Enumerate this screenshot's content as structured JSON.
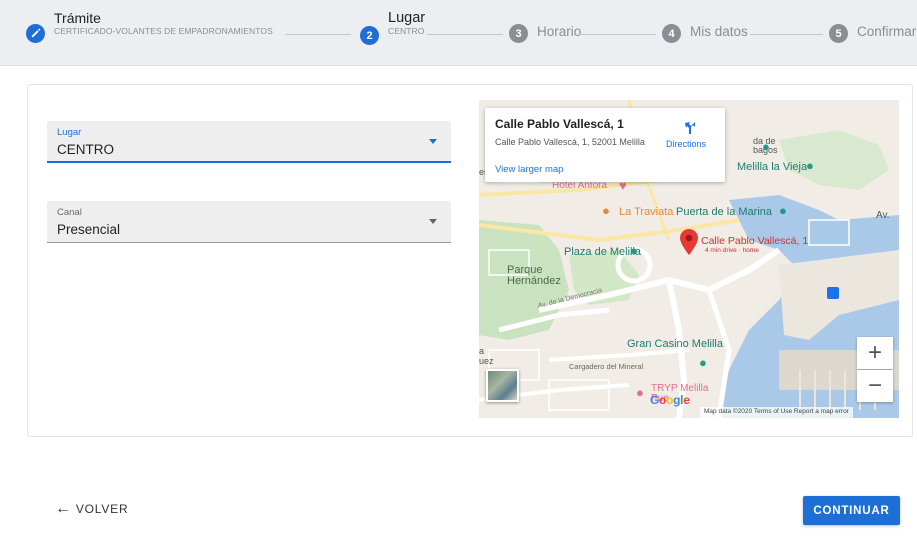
{
  "stepper": {
    "steps": [
      {
        "number": "",
        "title": "Trámite",
        "subtitle": "CERTIFICADO-VOLANTES DE EMPADRONAMIENTOS",
        "state": "done"
      },
      {
        "number": "2",
        "title": "Lugar",
        "subtitle": "CENTRO",
        "state": "active"
      },
      {
        "number": "3",
        "title": "Horario",
        "subtitle": "",
        "state": "todo"
      },
      {
        "number": "4",
        "title": "Mis datos",
        "subtitle": "",
        "state": "todo"
      },
      {
        "number": "5",
        "title": "Confirmar",
        "subtitle": "",
        "state": "todo"
      }
    ]
  },
  "form": {
    "lugar": {
      "label": "Lugar",
      "value": "CENTRO"
    },
    "canal": {
      "label": "Canal",
      "value": "Presencial"
    }
  },
  "map": {
    "popup": {
      "title": "Calle Pablo Vallescá, 1",
      "address": "Calle Pablo Vallescá, 1, 52001 Melilla",
      "directions": "Directions",
      "larger_map": "View larger map"
    },
    "marker_label": "Calle Pablo Vallescá, 1",
    "marker_sub": "4 min drive · home",
    "labels": {
      "hotel": "Hotel Anfora",
      "traviata": "La Traviata",
      "puerta": "Puerta de la Marina",
      "plaza": "Plaza de Melilla",
      "parque": "Parque\nHernández",
      "avenida": "Av. de la Democracia",
      "gran_casino": "Gran Casino Melilla",
      "cargadero": "Cargadero del Mineral",
      "tryp": "TRYP Melilla\nPue",
      "melilla_vieja": "Melilla la Vieja",
      "dade": "da de\nbagos",
      "av": "Av.",
      "es": "es",
      "a": "a",
      "uez": "uez"
    },
    "zoom_in": "+",
    "zoom_out": "−",
    "google": [
      "G",
      "o",
      "o",
      "g",
      "l",
      "e"
    ],
    "attribution": "Map data ©2020   Terms of Use   Report a map error"
  },
  "actions": {
    "back": "VOLVER",
    "continue": "CONTINUAR"
  },
  "colors": {
    "primary": "#1d6fd6",
    "muted": "#8a8d93"
  }
}
